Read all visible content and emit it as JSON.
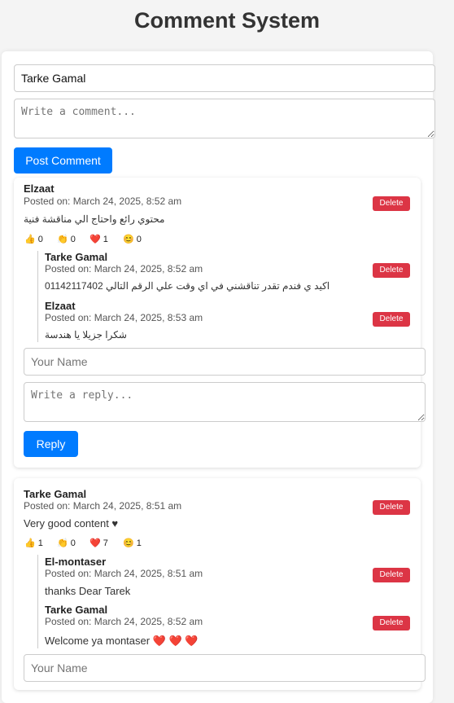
{
  "page": {
    "title": "Comment System"
  },
  "form": {
    "name_value": "Tarke Gamal",
    "comment_placeholder": "Write a comment...",
    "post_label": "Post Comment"
  },
  "comments": [
    {
      "author": "Elzaat",
      "date": "Posted on: March 24, 2025, 8:52 am",
      "text": "محتوي رائع واحتاج الي مناقشة فنية",
      "delete_label": "Delete",
      "reactions": {
        "like": "0",
        "clap": "0",
        "heart": "1",
        "smile": "0"
      },
      "replies": [
        {
          "author": "Tarke Gamal",
          "date": "Posted on: March 24, 2025, 8:52 am",
          "text": "اكيد ي فندم تقدر تناقشني في اي وقت علي الرقم التالي 01142117402",
          "delete_label": "Delete"
        },
        {
          "author": "Elzaat",
          "date": "Posted on: March 24, 2025, 8:53 am",
          "text": "شكرا جزيلا يا هندسة",
          "delete_label": "Delete"
        }
      ],
      "reply_form": {
        "name_placeholder": "Your Name",
        "reply_placeholder": "Write a reply...",
        "reply_label": "Reply"
      }
    },
    {
      "author": "Tarke Gamal",
      "date": "Posted on: March 24, 2025, 8:51 am",
      "text": "Very good content ♥",
      "delete_label": "Delete",
      "reactions": {
        "like": "1",
        "clap": "0",
        "heart": "7",
        "smile": "1"
      },
      "replies": [
        {
          "author": "El-montaser",
          "date": "Posted on: March 24, 2025, 8:51 am",
          "text": "thanks Dear Tarek",
          "delete_label": "Delete"
        },
        {
          "author": "Tarke Gamal",
          "date": "Posted on: March 24, 2025, 8:52 am",
          "text": "Welcome ya montaser ❤️ ❤️ ❤️",
          "delete_label": "Delete"
        }
      ],
      "reply_form": {
        "name_placeholder": "Your Name"
      }
    }
  ],
  "reaction_icons": {
    "like": "👍",
    "clap": "👏",
    "heart": "❤️",
    "smile": "😊"
  },
  "colors": {
    "accent": "#007bff",
    "delete": "#dc3545",
    "background": "#f4f4f4"
  }
}
